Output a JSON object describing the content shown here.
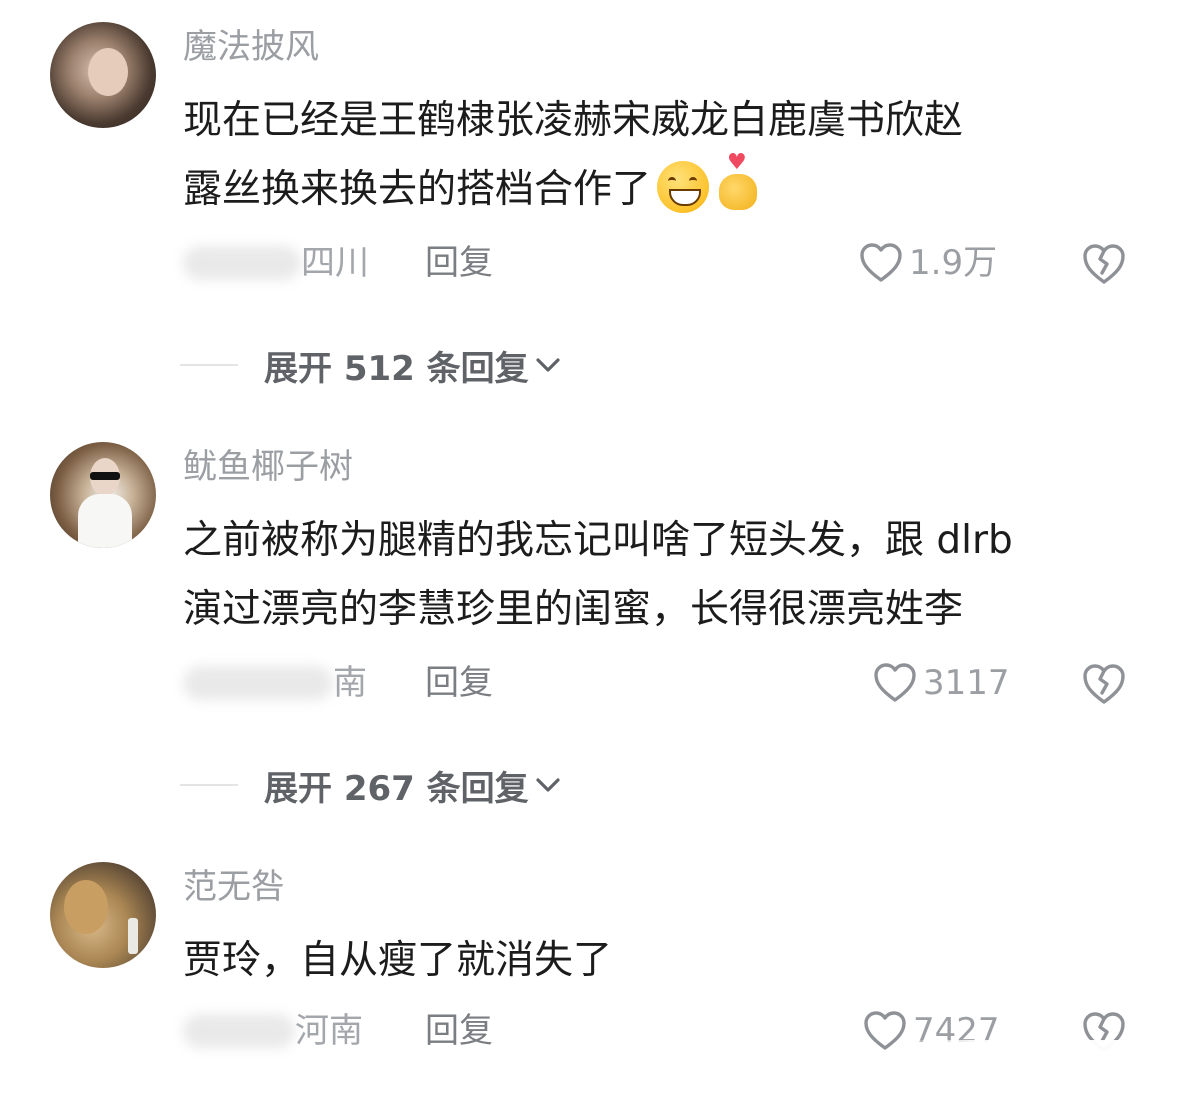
{
  "comments": [
    {
      "username": "魔法披风",
      "content_line1": "现在已经是王鹤棣张凌赫宋威龙白鹿虞书欣赵",
      "content_line2": "露丝换来换去的搭档合作了",
      "emoji1": "grin-icon",
      "emoji2": "heart-hand-icon",
      "location": "四川",
      "reply_label": "回复",
      "likes": "1.9万",
      "expand_label": "展开 512 条回复"
    },
    {
      "username": "鱿鱼椰子树",
      "content_line1": "之前被称为腿精的我忘记叫啥了短头发，跟 dlrb",
      "content_line2": "演过漂亮的李慧珍里的闺蜜，长得很漂亮姓李",
      "location": "南",
      "reply_label": "回复",
      "likes": "3117",
      "expand_label": "展开 267 条回复"
    },
    {
      "username": "范无咎",
      "content_line1": "贾玲，自从瘦了就消失了",
      "location": "河南",
      "reply_label": "回复",
      "likes": "7427"
    }
  ],
  "colors": {
    "username": "#9b9ea3",
    "content": "#1c1c1c",
    "expand_text": "#5f6266",
    "divider": "#e3e4e6"
  }
}
